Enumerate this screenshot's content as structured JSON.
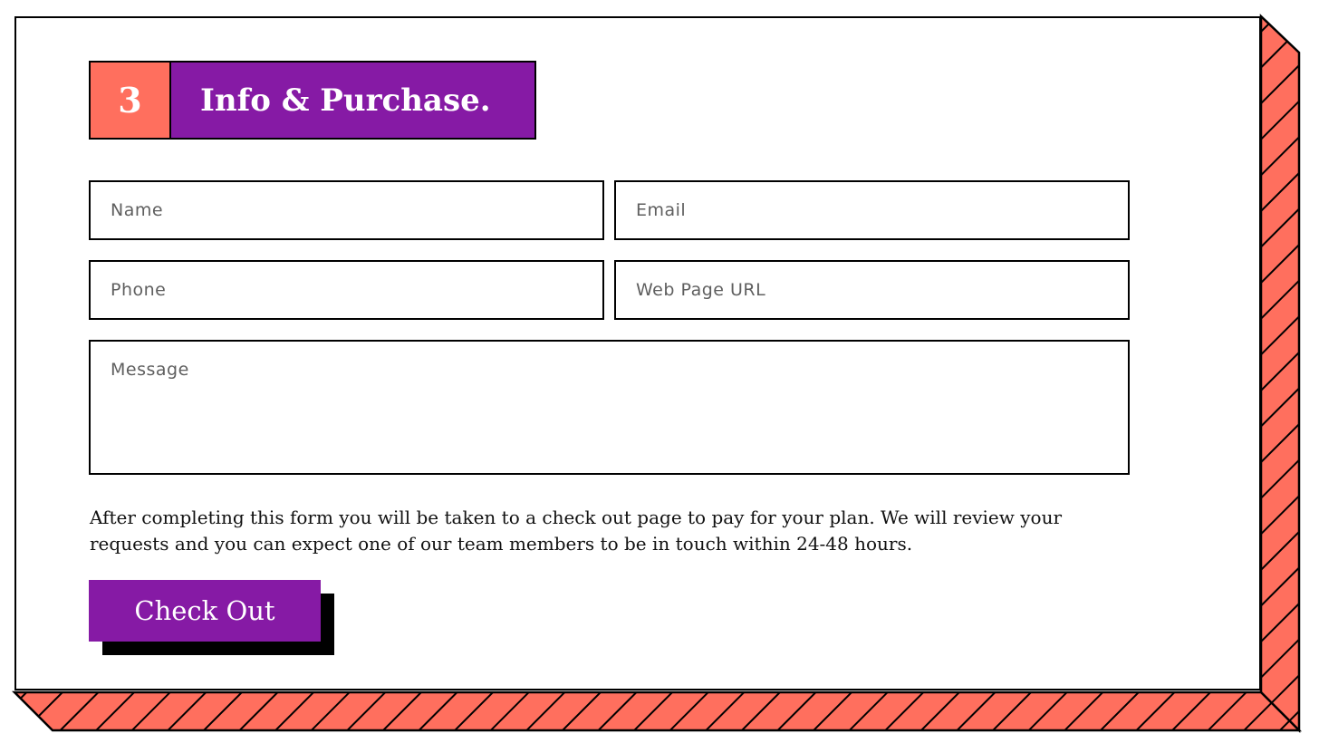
{
  "colors": {
    "accent_purple": "#861aa5",
    "accent_coral": "#ff6f5e",
    "outline": "#000000",
    "background": "#ffffff"
  },
  "step": {
    "number": "3",
    "title": "Info & Purchase."
  },
  "form": {
    "name_placeholder": "Name",
    "email_placeholder": "Email",
    "phone_placeholder": "Phone",
    "url_placeholder": "Web Page URL",
    "message_placeholder": "Message"
  },
  "info_text": "After completing this form you will be taken to a check out page to pay for your plan. We will review your requests and you can expect one of our team members to be in touch within 24-48 hours.",
  "checkout_label": "Check Out"
}
